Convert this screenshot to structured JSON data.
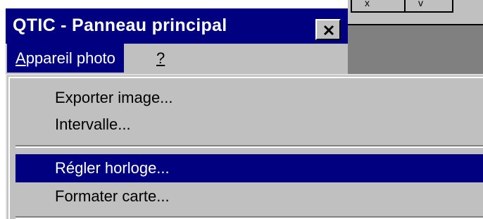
{
  "window": {
    "title": "QTIC - Panneau principal",
    "close_symbol": "×"
  },
  "menubar": {
    "items": [
      {
        "label": "Appareil photo",
        "mnemonic": "A",
        "rest": "ppareil photo",
        "active": true
      },
      {
        "label": "?",
        "active": false
      }
    ]
  },
  "dropdown": {
    "items": [
      {
        "label": "Exporter image...",
        "highlighted": false
      },
      {
        "label": "Intervalle...",
        "highlighted": false
      },
      {
        "label": "Régler horloge...",
        "highlighted": true
      },
      {
        "label": "Formater carte...",
        "highlighted": false
      }
    ]
  },
  "background_toolbar": {
    "buttons": [
      "x",
      "v"
    ]
  },
  "colors": {
    "titlebar": "#000080",
    "menu_face": "#c0c0c0",
    "highlight": "#000080",
    "background_window": "#808080"
  },
  "icons": {
    "close": "close-icon"
  }
}
